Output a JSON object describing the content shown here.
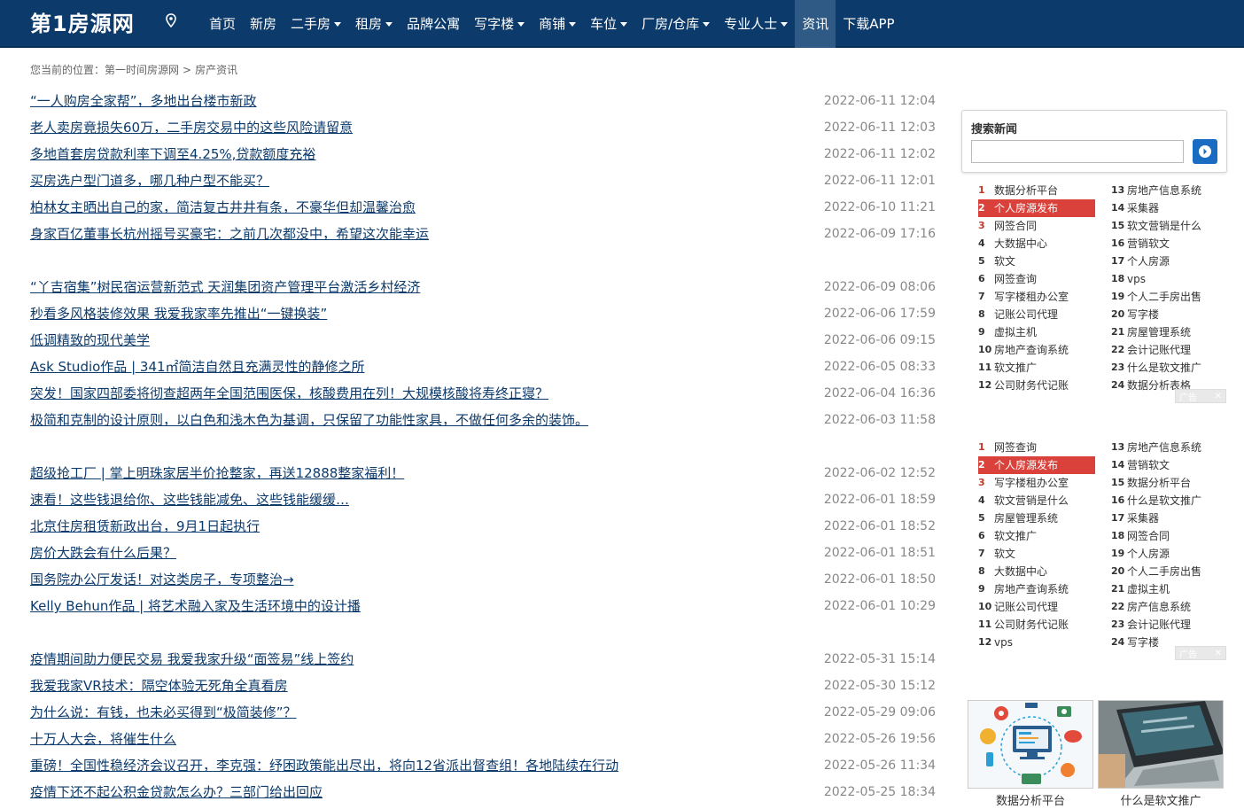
{
  "header": {
    "logo": "第1房源网",
    "nav": [
      {
        "label": "首页",
        "dropdown": false
      },
      {
        "label": "新房",
        "dropdown": false
      },
      {
        "label": "二手房",
        "dropdown": true
      },
      {
        "label": "租房",
        "dropdown": true
      },
      {
        "label": "品牌公寓",
        "dropdown": false
      },
      {
        "label": "写字楼",
        "dropdown": true
      },
      {
        "label": "商铺",
        "dropdown": true
      },
      {
        "label": "车位",
        "dropdown": true
      },
      {
        "label": "厂房/仓库",
        "dropdown": true
      },
      {
        "label": "专业人士",
        "dropdown": true
      },
      {
        "label": "资讯",
        "dropdown": false,
        "active": true
      },
      {
        "label": "下载APP",
        "dropdown": false
      }
    ]
  },
  "breadcrumb": {
    "prefix": "您当前的位置：",
    "home": "第一时间房源网",
    "separator": ">",
    "current": "房产资讯"
  },
  "news": [
    {
      "title": "“一人购房全家帮”，多地出台楼市新政",
      "date": "2022-06-11 12:04"
    },
    {
      "title": "老人卖房竟损失60万，二手房交易中的这些风险请留意",
      "date": "2022-06-11 12:03"
    },
    {
      "title": "多地首套房贷款利率下调至4.25%,贷款额度充裕",
      "date": "2022-06-11 12:02"
    },
    {
      "title": "买房选户型门道多，哪几种户型不能买？",
      "date": "2022-06-11 12:01"
    },
    {
      "title": "柏林女主晒出自己的家，简洁复古井井有条，不豪华但却温馨治愈",
      "date": "2022-06-10 11:21"
    },
    {
      "title": "身家百亿董事长杭州摇号买豪宅：之前几次都没中，希望这次能幸运",
      "date": "2022-06-09 17:16"
    },
    {
      "title": "“丫吉宿集”树民宿运营新范式 天润集团资产管理平台激活乡村经济",
      "date": "2022-06-09 08:06",
      "gap": true
    },
    {
      "title": "秒看多风格装修效果 我爱我家率先推出“一键换装”",
      "date": "2022-06-06 17:59"
    },
    {
      "title": "低调精致的现代美学",
      "date": "2022-06-06 09:15"
    },
    {
      "title": "Ask Studio作品 | 341㎡简洁自然且充满灵性的静修之所",
      "date": "2022-06-05 08:33"
    },
    {
      "title": "突发！国家四部委将彻查超两年全国范围医保，核酸费用在列！大规模核酸将寿终正寝？",
      "date": "2022-06-04 16:36"
    },
    {
      "title": "极简和克制的设计原则，以白色和浅木色为基调，只保留了功能性家具，不做任何多余的装饰。",
      "date": "2022-06-03 11:58"
    },
    {
      "title": "超级抢工厂 | 掌上明珠家居半价抢整家，再送12888整家福利！",
      "date": "2022-06-02 12:52",
      "gap": true
    },
    {
      "title": "速看！这些钱退给你、这些钱能减免、这些钱能缓缓…",
      "date": "2022-06-01 18:59"
    },
    {
      "title": "北京住房租赁新政出台，9月1日起执行",
      "date": "2022-06-01 18:52"
    },
    {
      "title": "房价大跌会有什么后果？",
      "date": "2022-06-01 18:51"
    },
    {
      "title": "国务院办公厅发话！对这类房子，专项整治→",
      "date": "2022-06-01 18:50"
    },
    {
      "title": "Kelly Behun作品 | 将艺术融入家及生活环境中的设计播",
      "date": "2022-06-01 10:29"
    },
    {
      "title": "疫情期间助力便民交易 我爱我家升级“面签易”线上签约",
      "date": "2022-05-31 15:14",
      "gap": true
    },
    {
      "title": "我爱我家VR技术：隔空体验无死角全真看房",
      "date": "2022-05-30 15:12"
    },
    {
      "title": "为什么说：有钱，也未必买得到“极简装修”？",
      "date": "2022-05-29 09:06"
    },
    {
      "title": "十万人大会，将催生什么",
      "date": "2022-05-26 19:56"
    },
    {
      "title": "重磅！全国性稳经济会议召开，李克强：纾困政策能出尽出，将向12省派出督查组！各地陆续在行动",
      "date": "2022-05-26 11:34"
    },
    {
      "title": "疫情下还不起公积金贷款怎么办？三部门给出回应",
      "date": "2022-05-25 18:34"
    }
  ],
  "search": {
    "title": "搜索新闻",
    "placeholder": "",
    "button_icon": "arrow-right-icon"
  },
  "rank1": {
    "left": [
      "数据分析平台",
      "个人房源发布",
      "网签合同",
      "大数据中心",
      "软文",
      "网签查询",
      "写字楼租办公室",
      "记账公司代理",
      "虚拟主机",
      "房地产查询系统",
      "软文推广",
      "公司财务代记账"
    ],
    "right": [
      "房地产信息系统",
      "采集器",
      "软文营销是什么",
      "营销软文",
      "个人房源",
      "vps",
      "个人二手房出售",
      "写字楼",
      "房屋管理系统",
      "会计记账代理",
      "什么是软文推广",
      "数据分析表格"
    ],
    "highlight_index": 1,
    "ad": "广告"
  },
  "rank2": {
    "left": [
      "网签查询",
      "个人房源发布",
      "写字楼租办公室",
      "软文营销是什么",
      "房屋管理系统",
      "软文推广",
      "软文",
      "大数据中心",
      "房地产查询系统",
      "记账公司代理",
      "公司财务代记账",
      "vps"
    ],
    "right": [
      "房地产信息系统",
      "营销软文",
      "数据分析平台",
      "什么是软文推广",
      "采集器",
      "网签合同",
      "个人房源",
      "个人二手房出售",
      "虚拟主机",
      "房产信息系统",
      "会计记账代理",
      "写字楼"
    ],
    "highlight_index": 1,
    "ad": "广告"
  },
  "thumbs": [
    {
      "caption": "数据分析平台",
      "icon": "data-network-illustration"
    },
    {
      "caption": "什么是软文推广",
      "icon": "laptop-desk-photo"
    }
  ],
  "colors": {
    "header_bg": "#0c3a6b",
    "nav_active_bg": "#2f5a86",
    "link": "#0c3a6b",
    "rank_highlight": "#d9413a",
    "rank_top_num": "#c0392b",
    "search_button": "#1a6bc2"
  }
}
